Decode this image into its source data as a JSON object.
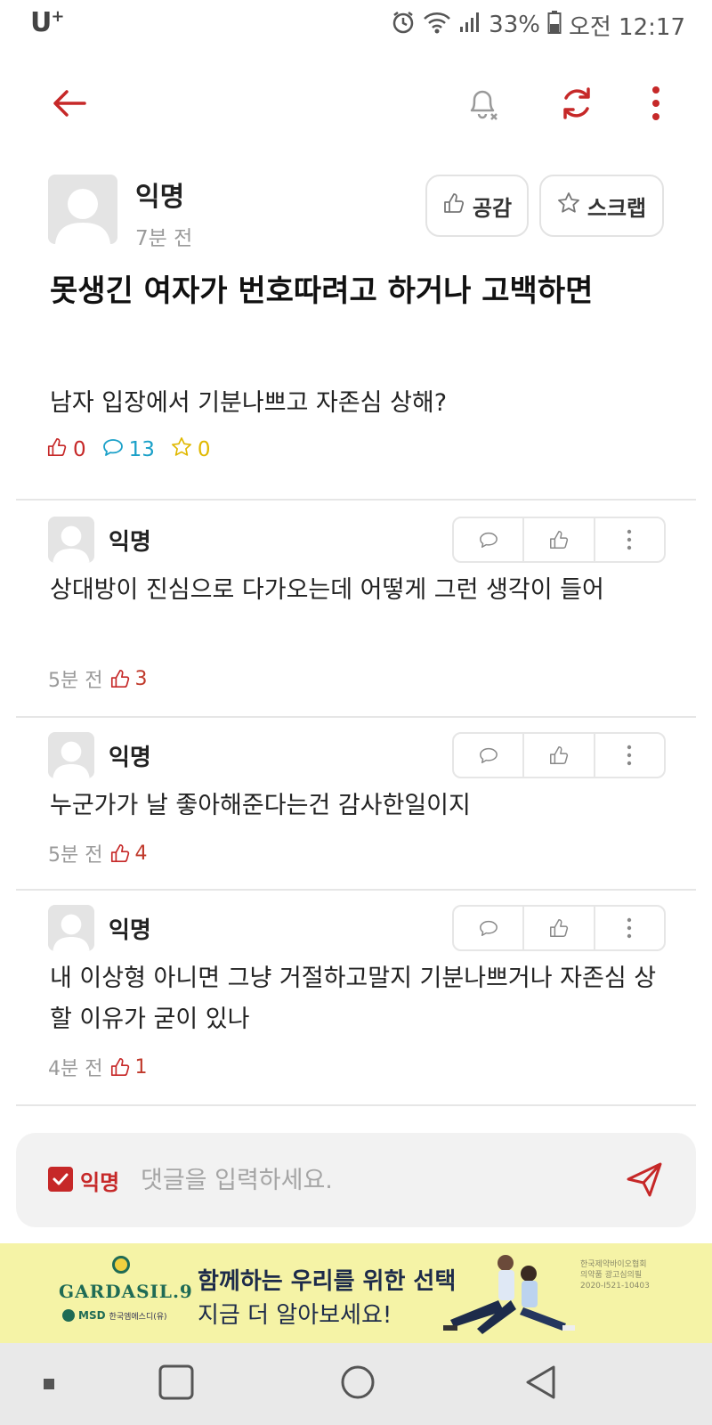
{
  "status_bar": {
    "carrier": "U",
    "carrier_sup": "+",
    "battery": "33%",
    "time": "오전 12:17"
  },
  "post": {
    "author": "익명",
    "time": "7분 전",
    "like_button": "공감",
    "scrap_button": "스크랩",
    "title": "못생긴 여자가 번호따려고 하거나 고백하면",
    "body": "남자 입장에서 기분나쁘고 자존심 상해?",
    "likes": "0",
    "comments": "13",
    "scraps": "0"
  },
  "comments": [
    {
      "author": "익명",
      "text": "상대방이 진심으로 다가오는데 어떻게 그런 생각이 들어",
      "time": "5분 전",
      "likes": "3"
    },
    {
      "author": "익명",
      "text": "누군가가 날 좋아해준다는건 감사한일이지",
      "time": "5분 전",
      "likes": "4"
    },
    {
      "author": "익명",
      "text": "내 이상형 아니면 그냥 거절하고말지 기분나쁘거나 자존심 상할 이유가 굳이 있나",
      "time": "4분 전",
      "likes": "1"
    }
  ],
  "comment_input": {
    "anon_label": "익명",
    "placeholder": "댓글을 입력하세요."
  },
  "ad": {
    "brand": "GARDASIL.9",
    "company": "MSD",
    "company_ko": "한국엠에스디(유)",
    "line1": "함께하는 우리를 위한 선택",
    "line2": "지금 더 알아보세요!",
    "note_1": "한국제약바이오협회",
    "note_2": "의약품 광고심의필",
    "note_3": "2020-I521-10403"
  },
  "colors": {
    "accent_red": "#c62828",
    "comment_blue": "#1aa0c8",
    "scrap_yellow": "#e0b800"
  }
}
